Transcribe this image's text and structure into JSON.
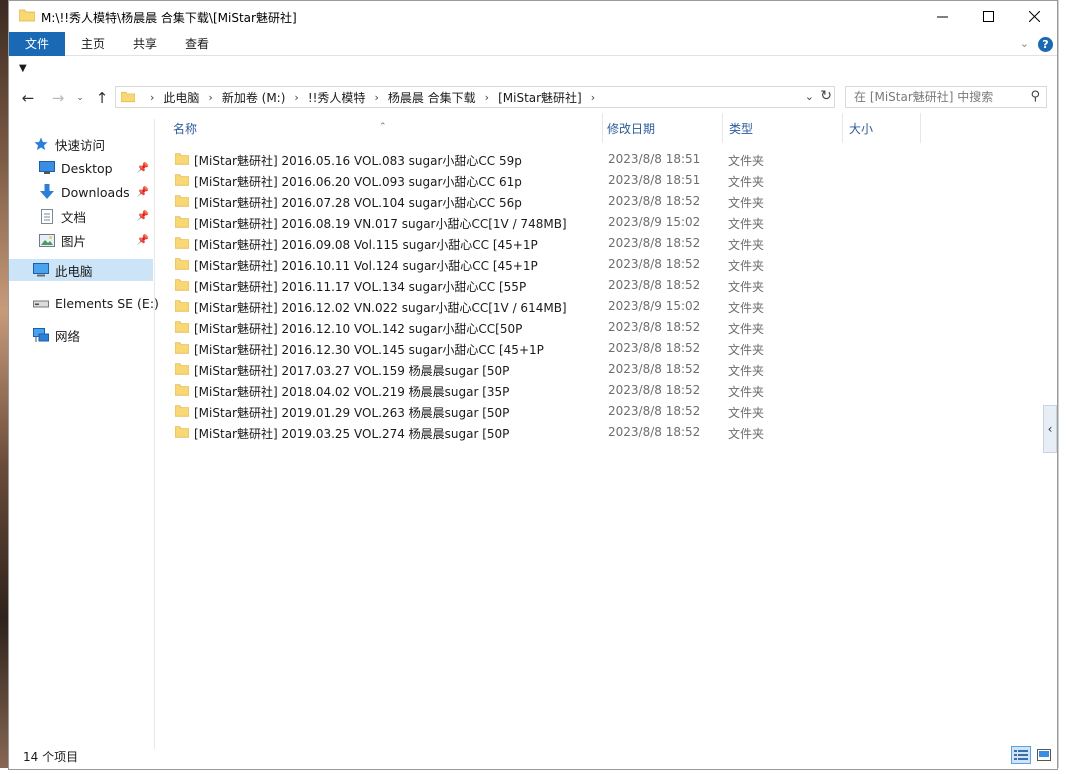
{
  "window": {
    "title": "M:\\!!秀人模特\\杨晨晨 合集下载\\[MiStar魅研社]"
  },
  "ribbon": {
    "tabs": [
      "文件",
      "主页",
      "共享",
      "查看"
    ],
    "help": "?"
  },
  "address": {
    "crumbs": [
      "此电脑",
      "新加卷 (M:)",
      "!!秀人模特",
      "杨晨晨 合集下载",
      "[MiStar魅研社]"
    ]
  },
  "search": {
    "placeholder": "在 [MiStar魅研社] 中搜索"
  },
  "navpane": {
    "items": [
      {
        "label": "快速访问",
        "icon": "star-icon"
      },
      {
        "label": "Desktop",
        "icon": "desktop-icon",
        "pinned": true
      },
      {
        "label": "Downloads",
        "icon": "download-icon",
        "pinned": true
      },
      {
        "label": "文档",
        "icon": "document-icon",
        "pinned": true
      },
      {
        "label": "图片",
        "icon": "picture-icon",
        "pinned": true
      },
      {
        "label": "此电脑",
        "icon": "computer-icon",
        "selected": true
      },
      {
        "label": "Elements SE (E:)",
        "icon": "drive-icon"
      },
      {
        "label": "网络",
        "icon": "network-icon"
      }
    ]
  },
  "columns": {
    "name": "名称",
    "date": "修改日期",
    "type": "类型",
    "size": "大小"
  },
  "files": [
    {
      "name": "[MiStar魅研社] 2016.05.16 VOL.083 sugar小甜心CC 59p",
      "date": "2023/8/8 18:51",
      "type": "文件夹"
    },
    {
      "name": "[MiStar魅研社] 2016.06.20 VOL.093 sugar小甜心CC 61p",
      "date": "2023/8/8 18:51",
      "type": "文件夹"
    },
    {
      "name": "[MiStar魅研社] 2016.07.28 VOL.104 sugar小甜心CC 56p",
      "date": "2023/8/8 18:52",
      "type": "文件夹"
    },
    {
      "name": "[MiStar魅研社] 2016.08.19 VN.017 sugar小甜心CC[1V / 748MB]",
      "date": "2023/8/9 15:02",
      "type": "文件夹"
    },
    {
      "name": "[MiStar魅研社] 2016.09.08 Vol.115 sugar小甜心CC [45+1P",
      "date": "2023/8/8 18:52",
      "type": "文件夹"
    },
    {
      "name": "[MiStar魅研社] 2016.10.11 Vol.124 sugar小甜心CC [45+1P",
      "date": "2023/8/8 18:52",
      "type": "文件夹"
    },
    {
      "name": "[MiStar魅研社] 2016.11.17 VOL.134 sugar小甜心CC [55P",
      "date": "2023/8/8 18:52",
      "type": "文件夹"
    },
    {
      "name": "[MiStar魅研社] 2016.12.02 VN.022 sugar小甜心CC[1V / 614MB]",
      "date": "2023/8/9 15:02",
      "type": "文件夹"
    },
    {
      "name": "[MiStar魅研社] 2016.12.10 VOL.142 sugar小甜心CC[50P",
      "date": "2023/8/8 18:52",
      "type": "文件夹"
    },
    {
      "name": "[MiStar魅研社] 2016.12.30 VOL.145 sugar小甜心CC [45+1P",
      "date": "2023/8/8 18:52",
      "type": "文件夹"
    },
    {
      "name": "[MiStar魅研社] 2017.03.27 VOL.159 杨晨晨sugar [50P",
      "date": "2023/8/8 18:52",
      "type": "文件夹"
    },
    {
      "name": "[MiStar魅研社] 2018.04.02 VOL.219 杨晨晨sugar [35P",
      "date": "2023/8/8 18:52",
      "type": "文件夹"
    },
    {
      "name": "[MiStar魅研社] 2019.01.29 VOL.263 杨晨晨sugar [50P",
      "date": "2023/8/8 18:52",
      "type": "文件夹"
    },
    {
      "name": "[MiStar魅研社] 2019.03.25 VOL.274 杨晨晨sugar [50P",
      "date": "2023/8/8 18:52",
      "type": "文件夹"
    }
  ],
  "status": {
    "count": "14 个项目"
  },
  "colors": {
    "accent": "#1a69b5",
    "folder": "#f8d775",
    "folder_dark": "#e8b84a",
    "selection": "#cce4f7",
    "header_text": "#2d5b9a"
  }
}
